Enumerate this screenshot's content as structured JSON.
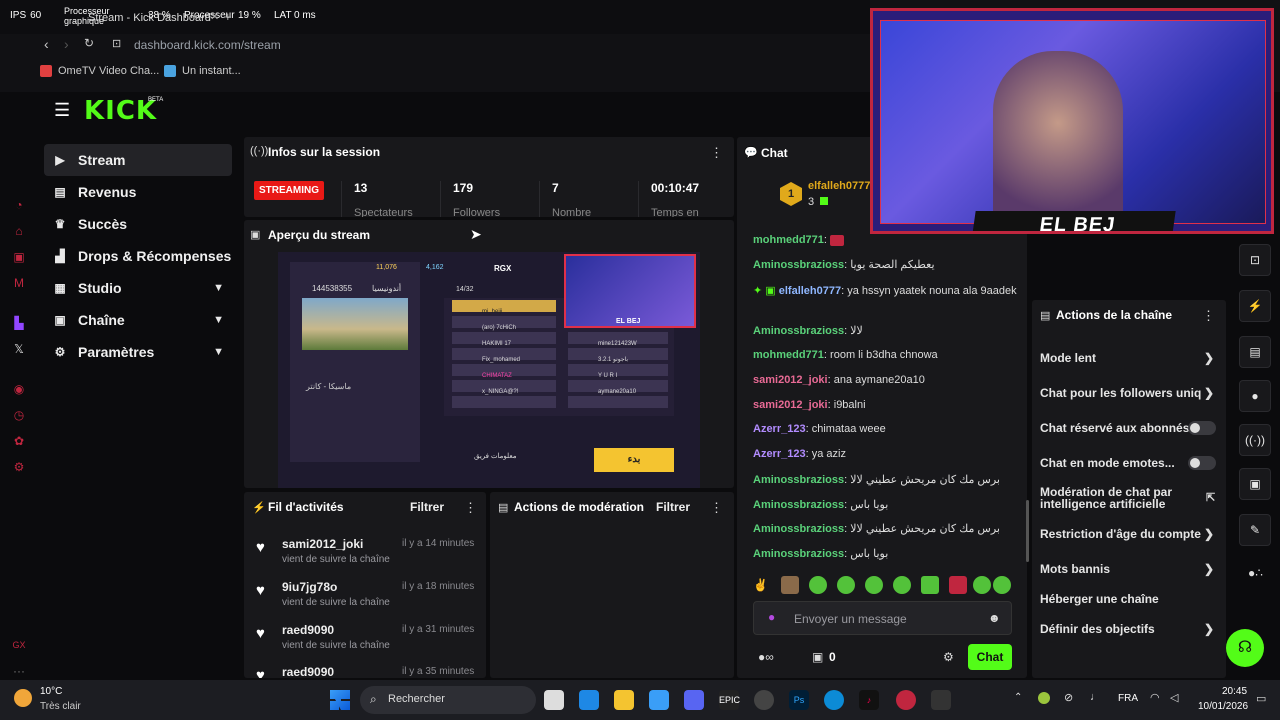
{
  "overlay": {
    "ips_label": "IPS",
    "ips_value": "60",
    "gpu_label": "Processeur graphique",
    "gpu_value": "38 %",
    "cpu_label": "Processeur",
    "cpu_value": "19 %",
    "lat_label": "LAT",
    "lat_value": "0 ms"
  },
  "browser": {
    "tab_title": "Stream - Kick Dashboard",
    "url": "dashboard.kick.com/stream",
    "bookmarks": [
      "OmeTV Video Cha...",
      "Un instant..."
    ]
  },
  "app": {
    "logo": "KICK",
    "logo_badge": "BETA"
  },
  "sidebar": {
    "items": [
      {
        "label": "Stream",
        "icon": "video-icon",
        "chevron": ""
      },
      {
        "label": "Revenus",
        "icon": "chart-icon",
        "chevron": ""
      },
      {
        "label": "Succès",
        "icon": "trophy-icon",
        "chevron": ""
      },
      {
        "label": "Drops & Récompenses",
        "icon": "gift-icon",
        "chevron": ""
      },
      {
        "label": "Studio",
        "icon": "studio-icon",
        "chevron": "v"
      },
      {
        "label": "Chaîne",
        "icon": "channel-icon",
        "chevron": "v"
      },
      {
        "label": "Paramètres",
        "icon": "gear-icon",
        "chevron": "v"
      }
    ]
  },
  "session": {
    "title": "Infos sur la session",
    "status": "STREAMING",
    "stats": [
      {
        "value": "13",
        "label": "Spectateurs"
      },
      {
        "value": "179",
        "label": "Followers"
      },
      {
        "value": "7",
        "label": "Nombre"
      },
      {
        "value": "00:10:47",
        "label": "Temps en"
      }
    ]
  },
  "preview": {
    "title": "Aperçu du stream",
    "game_id": "144538355",
    "game_mode": "أندونيسيا",
    "stat_a": "11,076",
    "stat_b": "4,162",
    "players_count": "14/32",
    "players_left": [
      "mi_heiji",
      "(aro) 7cHiCh",
      "HAKIMI 17",
      "Fix_mohamed",
      "CHIMATAZ",
      "x_NINGA@?!"
    ],
    "players_right": [
      "mine121423W",
      "3.2.1 باجونو",
      "Y U R I",
      "aymane20a10"
    ],
    "slot_left": [
      "1",
      "3",
      "5",
      "7",
      "9",
      "11",
      "13"
    ],
    "slot_right": [
      "6",
      "8",
      "10",
      "12",
      "14"
    ],
    "map_label": "ماسيكا - كانتر",
    "cam_label": "EL BEJ",
    "team_label": "معلومات فريق",
    "start_label": "بدء",
    "rgx_label": "RGX"
  },
  "activity": {
    "title": "Fil d'activités",
    "filter": "Filtrer",
    "items": [
      {
        "name": "sami2012_joki",
        "time": "il y a 14 minutes",
        "desc": "vient de suivre la chaîne"
      },
      {
        "name": "9iu7jg78o",
        "time": "il y a 18 minutes",
        "desc": "vient de suivre la chaîne"
      },
      {
        "name": "raed9090",
        "time": "il y a 31 minutes",
        "desc": "vient de suivre la chaîne"
      },
      {
        "name": "raed9090",
        "time": "il y a 35 minutes",
        "desc": ""
      }
    ]
  },
  "moderation": {
    "title": "Actions de modération",
    "filter": "Filtrer"
  },
  "chat": {
    "title": "Chat",
    "top_user": "elfalleh0777",
    "top_rank": "1",
    "top_count": "3",
    "messages": [
      {
        "user": "mohmedd771",
        "color": "#5ad17a",
        "text": ""
      },
      {
        "user": "Aminossbrazioss",
        "color": "#5ad17a",
        "text": "يعطيكم الصحة يويا"
      },
      {
        "user": "elfalleh0777",
        "color": "#8fb7ff",
        "text": "ya hssyn yaatek nouna ala 9aadek"
      },
      {
        "user": "Aminossbrazioss",
        "color": "#5ad17a",
        "text": "لالا"
      },
      {
        "user": "mohmedd771",
        "color": "#5ad17a",
        "text": "room li b3dha chnowa"
      },
      {
        "user": "sami2012_joki",
        "color": "#e86a95",
        "text": "ana aymane20a10"
      },
      {
        "user": "sami2012_joki",
        "color": "#e86a95",
        "text": "i9balni"
      },
      {
        "user": "Azerr_123",
        "color": "#b28cff",
        "text": "chimataa weee"
      },
      {
        "user": "Azerr_123",
        "color": "#b28cff",
        "text": "ya aziz"
      },
      {
        "user": "Aminossbrazioss",
        "color": "#5ad17a",
        "text": "برس مك كان مريحش عطيني لالا"
      },
      {
        "user": "Aminossbrazioss",
        "color": "#5ad17a",
        "text": "بويا باس"
      },
      {
        "user": "Aminossbrazioss",
        "color": "#5ad17a",
        "text": "برس مك كان مريحش عطيني لالا"
      },
      {
        "user": "Aminossbrazioss",
        "color": "#5ad17a",
        "text": "بويا باس"
      }
    ],
    "input_placeholder": "Envoyer un message",
    "footer_count": "0",
    "send_label": "Chat"
  },
  "webcam": {
    "name": "EL BEJ"
  },
  "channel_actions": {
    "title": "Actions de la chaîne",
    "items": [
      {
        "label": "Mode lent",
        "kind": "chevron"
      },
      {
        "label": "Chat pour les followers uniq",
        "kind": "chevron"
      },
      {
        "label": "Chat réservé aux abonnés",
        "kind": "toggle"
      },
      {
        "label": "Chat en mode emotes...",
        "kind": "toggle"
      },
      {
        "label": "Modération de chat par intelligence artificielle",
        "kind": "external"
      },
      {
        "label": "Restriction d'âge du compte",
        "kind": "chevron"
      },
      {
        "label": "Mots bannis",
        "kind": "chevron"
      },
      {
        "label": "Héberger une chaîne",
        "kind": "none"
      },
      {
        "label": "Définir des objectifs",
        "kind": "chevron"
      }
    ]
  },
  "taskbar": {
    "weather_temp": "10°C",
    "weather_desc": "Très clair",
    "search": "Rechercher",
    "lang": "FRA",
    "time": "20:45",
    "date": "10/01/2026"
  },
  "colors": {
    "kick_green": "#53fc18",
    "streaming_red": "#e91916",
    "panel_bg": "#18181b",
    "accent_red": "#c0263f"
  }
}
